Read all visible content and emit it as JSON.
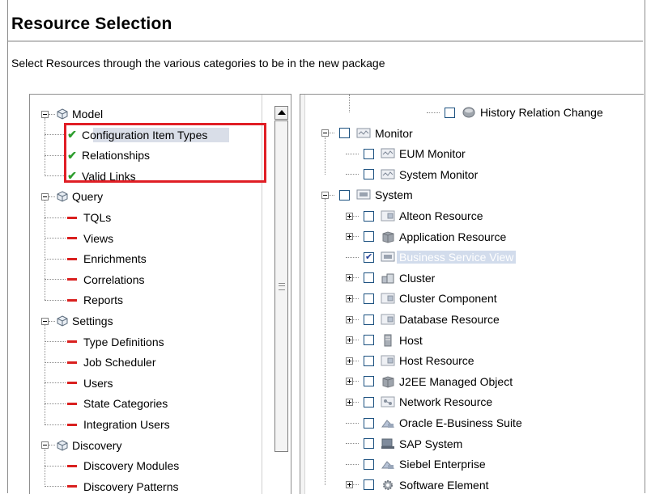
{
  "header": {
    "title": "Resource Selection",
    "description": "Select Resources through the various categories to be in the new package"
  },
  "colors": {
    "included": "#2e9e2e",
    "excluded": "#d9201f",
    "highlight_border": "#e01e25",
    "checkbox_border": "#1c5180"
  },
  "left_tree": {
    "categories": [
      {
        "label": "Model",
        "icon": "cube-icon",
        "items": [
          {
            "label": "Configuration Item Types",
            "status": "check",
            "selected": true
          },
          {
            "label": "Relationships",
            "status": "check"
          },
          {
            "label": "Valid Links",
            "status": "check"
          }
        ]
      },
      {
        "label": "Query",
        "icon": "cube-icon",
        "items": [
          {
            "label": "TQLs",
            "status": "dash"
          },
          {
            "label": "Views",
            "status": "dash"
          },
          {
            "label": "Enrichments",
            "status": "dash"
          },
          {
            "label": "Correlations",
            "status": "dash"
          },
          {
            "label": "Reports",
            "status": "dash"
          }
        ]
      },
      {
        "label": "Settings",
        "icon": "cube-icon",
        "items": [
          {
            "label": "Type Definitions",
            "status": "dash"
          },
          {
            "label": "Job Scheduler",
            "status": "dash"
          },
          {
            "label": "Users",
            "status": "dash"
          },
          {
            "label": "State Categories",
            "status": "dash"
          },
          {
            "label": "Integration Users",
            "status": "dash"
          }
        ]
      },
      {
        "label": "Discovery",
        "icon": "cube-icon",
        "items": [
          {
            "label": "Discovery Modules",
            "status": "dash"
          },
          {
            "label": "Discovery Patterns",
            "status": "dash"
          }
        ]
      }
    ]
  },
  "right_tree": {
    "rows": [
      {
        "label": "History Relation Change",
        "level": 2,
        "toggle": "none",
        "checked": false,
        "icon": "disk-icon"
      },
      {
        "label": "Monitor",
        "level": 0,
        "toggle": "minus",
        "checked": false,
        "icon": "monitor-icon"
      },
      {
        "label": "EUM Monitor",
        "level": 1,
        "toggle": "none",
        "checked": false,
        "icon": "monitor-icon"
      },
      {
        "label": "System Monitor",
        "level": 1,
        "toggle": "none",
        "checked": false,
        "icon": "monitor-icon"
      },
      {
        "label": "System",
        "level": 0,
        "toggle": "minus",
        "checked": false,
        "icon": "system-icon"
      },
      {
        "label": "Alteon Resource",
        "level": 1,
        "toggle": "plus",
        "checked": false,
        "icon": "resource-icon"
      },
      {
        "label": "Application Resource",
        "level": 1,
        "toggle": "plus",
        "checked": false,
        "icon": "box-icon"
      },
      {
        "label": "Business Service View",
        "level": 1,
        "toggle": "none",
        "checked": true,
        "icon": "system-icon",
        "selected": true
      },
      {
        "label": "Cluster",
        "level": 1,
        "toggle": "plus",
        "checked": false,
        "icon": "cluster-icon"
      },
      {
        "label": "Cluster Component",
        "level": 1,
        "toggle": "plus",
        "checked": false,
        "icon": "resource-icon"
      },
      {
        "label": "Database Resource",
        "level": 1,
        "toggle": "plus",
        "checked": false,
        "icon": "resource-icon"
      },
      {
        "label": "Host",
        "level": 1,
        "toggle": "plus",
        "checked": false,
        "icon": "host-icon"
      },
      {
        "label": "Host Resource",
        "level": 1,
        "toggle": "plus",
        "checked": false,
        "icon": "resource-icon"
      },
      {
        "label": "J2EE Managed Object",
        "level": 1,
        "toggle": "plus",
        "checked": false,
        "icon": "box-icon"
      },
      {
        "label": "Network Resource",
        "level": 1,
        "toggle": "plus",
        "checked": false,
        "icon": "network-icon"
      },
      {
        "label": "Oracle E-Business Suite",
        "level": 1,
        "toggle": "none",
        "checked": false,
        "icon": "app-icon"
      },
      {
        "label": "SAP System",
        "level": 1,
        "toggle": "none",
        "checked": false,
        "icon": "sap-icon"
      },
      {
        "label": "Siebel Enterprise",
        "level": 1,
        "toggle": "none",
        "checked": false,
        "icon": "app-icon"
      },
      {
        "label": "Software Element",
        "level": 1,
        "toggle": "plus",
        "checked": false,
        "icon": "gear-icon"
      }
    ]
  }
}
